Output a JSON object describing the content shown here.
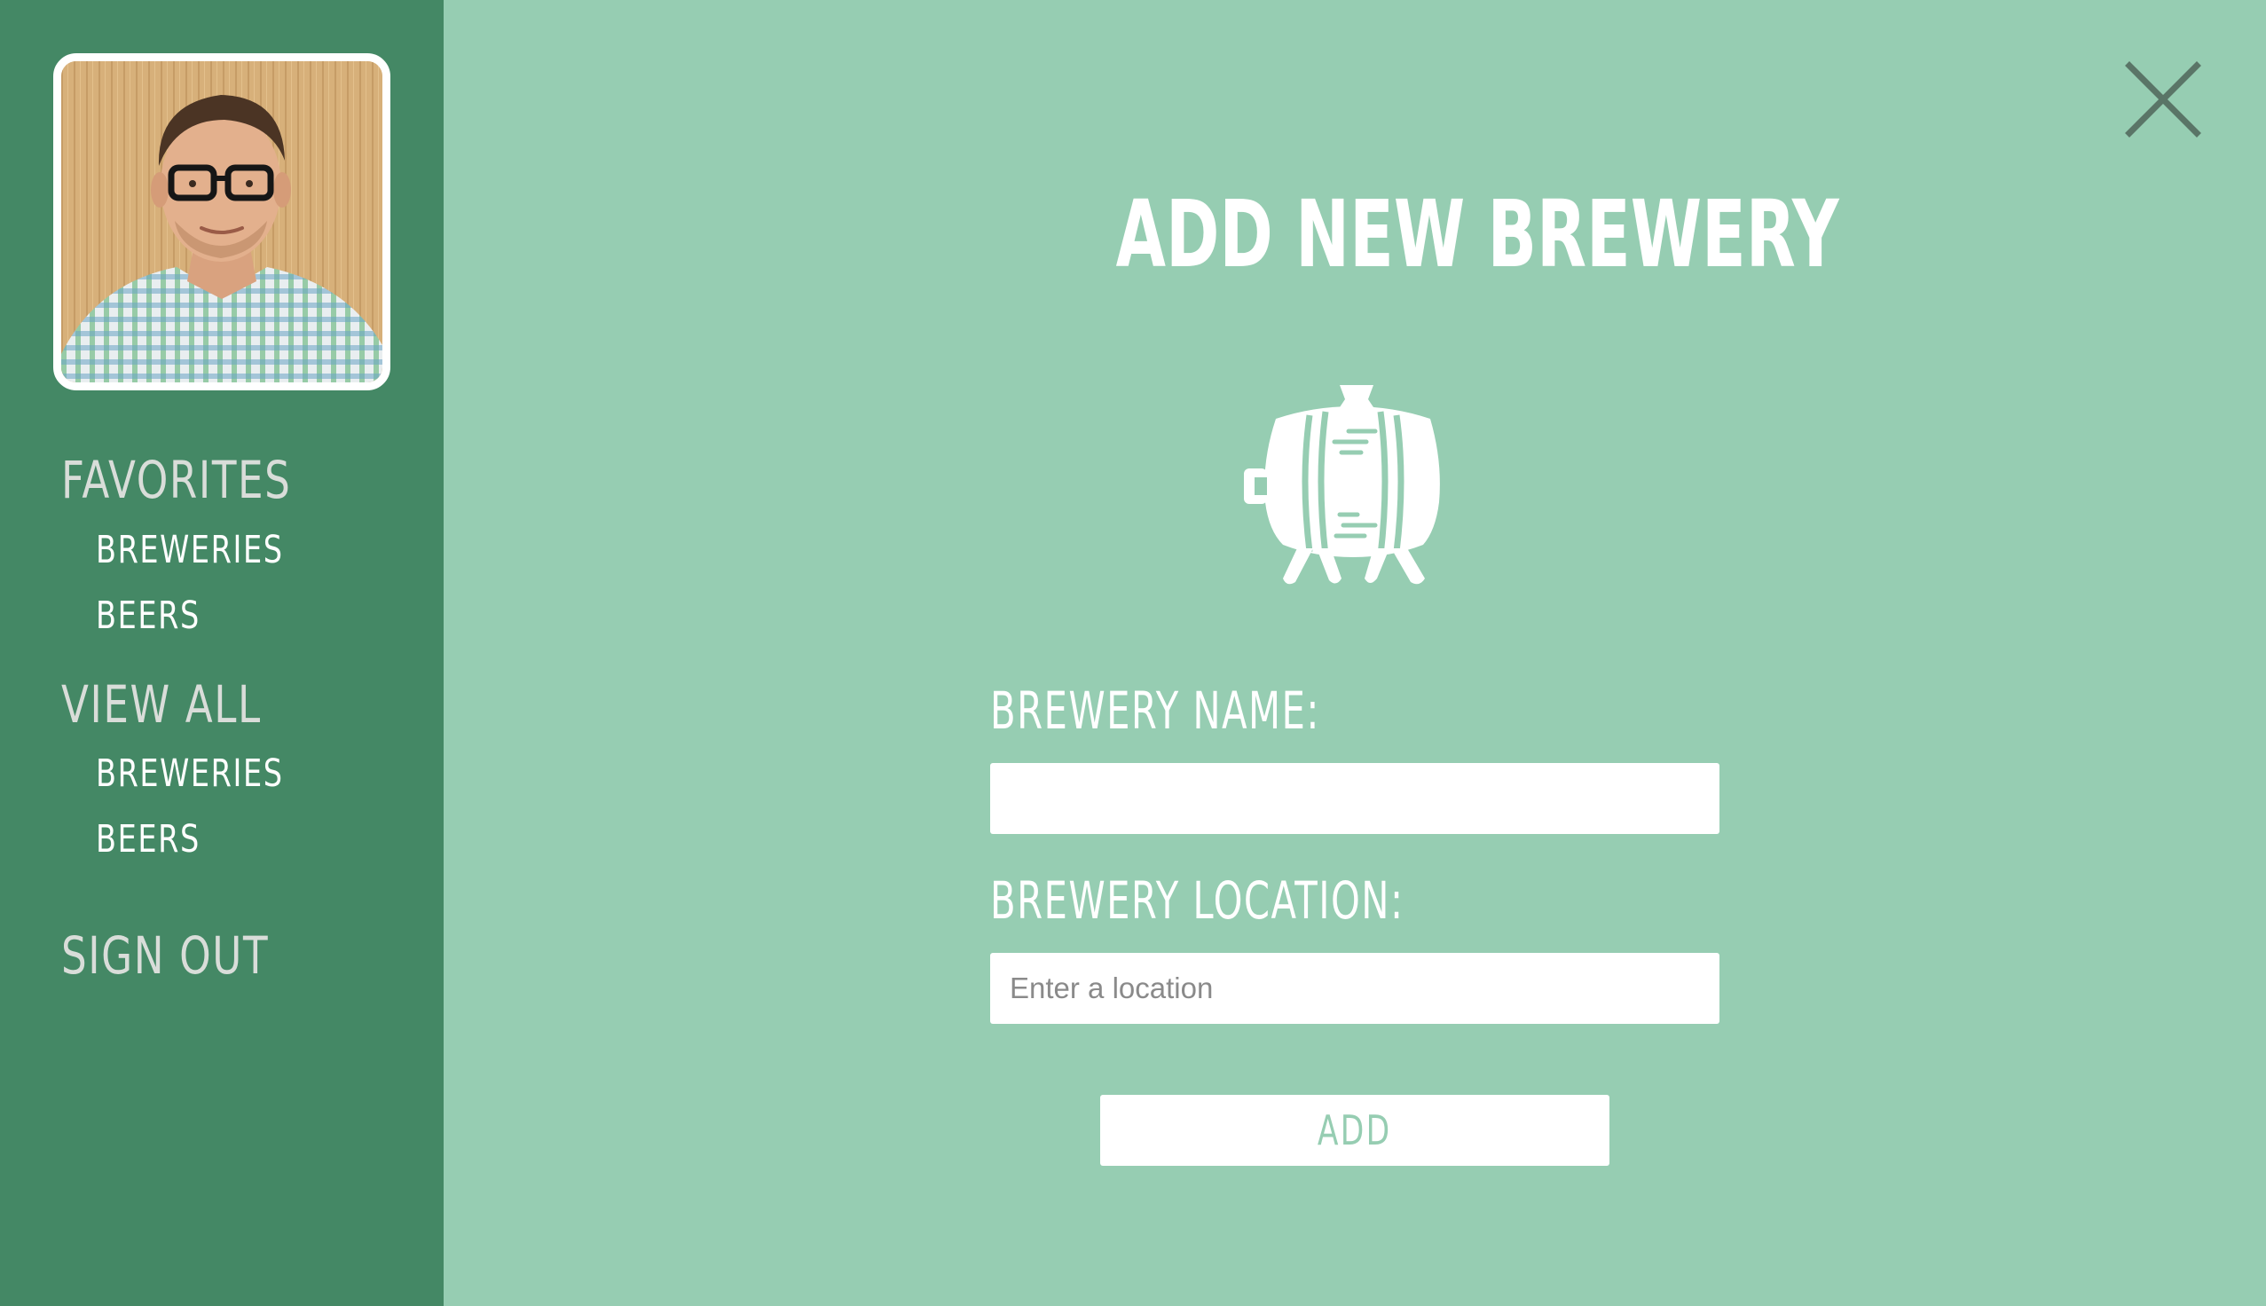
{
  "sidebar": {
    "favorites_heading": "FAVORITES",
    "favorites_items": [
      "BREWERIES",
      "BEERS"
    ],
    "view_all_heading": "VIEW ALL",
    "view_all_items": [
      "BREWERIES",
      "BEERS"
    ],
    "sign_out": "SIGN OUT"
  },
  "modal": {
    "title": "ADD NEW BREWERY",
    "icon": "beer-keg-icon",
    "name_label": "BREWERY NAME:",
    "name_value": "",
    "location_label": "BREWERY LOCATION:",
    "location_placeholder": "Enter a location",
    "location_value": "",
    "add_button": "ADD",
    "close_icon": "close-icon"
  },
  "colors": {
    "sidebar_bg": "#448865",
    "main_bg": "#96cdb2",
    "heading_text": "#d9ddd9",
    "white": "#ffffff",
    "close_icon": "#5a7567"
  }
}
